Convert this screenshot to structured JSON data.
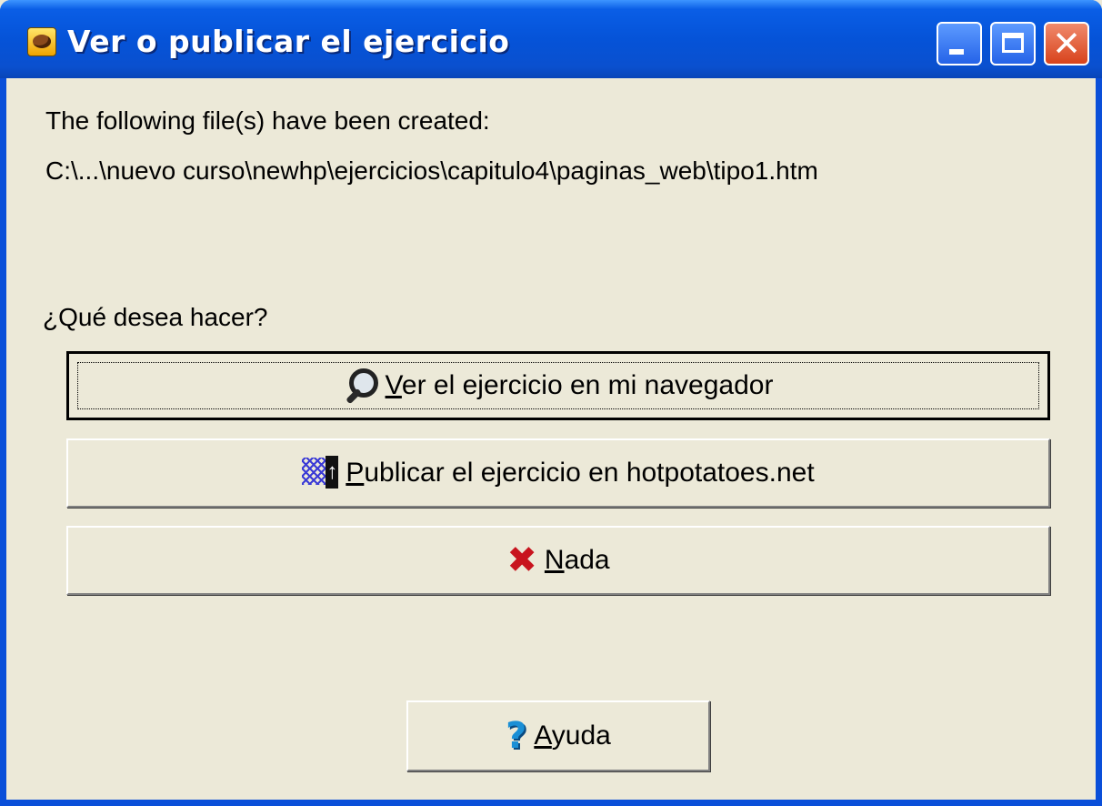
{
  "window": {
    "title": "Ver o publicar el ejercicio"
  },
  "message": {
    "line1": "The following file(s) have been created:",
    "line2": "C:\\...\\nuevo curso\\newhp\\ejercicios\\capitulo4\\paginas_web\\tipo1.htm"
  },
  "question": "¿Qué desea hacer?",
  "buttons": {
    "view": {
      "mnemonic": "V",
      "rest": "er el ejercicio en mi navegador",
      "icon": "magnifier-icon"
    },
    "publish": {
      "mnemonic": "P",
      "rest": "ublicar el ejercicio en hotpotatoes.net",
      "icon": "web-upload-icon"
    },
    "nothing": {
      "mnemonic": "N",
      "rest": "ada",
      "icon": "red-x-icon"
    },
    "help": {
      "mnemonic": "A",
      "rest": "yuda",
      "icon": "help-question-icon"
    }
  },
  "colors": {
    "titlebar": "#0553d8",
    "face": "#ece9d8",
    "close": "#d8431c"
  }
}
